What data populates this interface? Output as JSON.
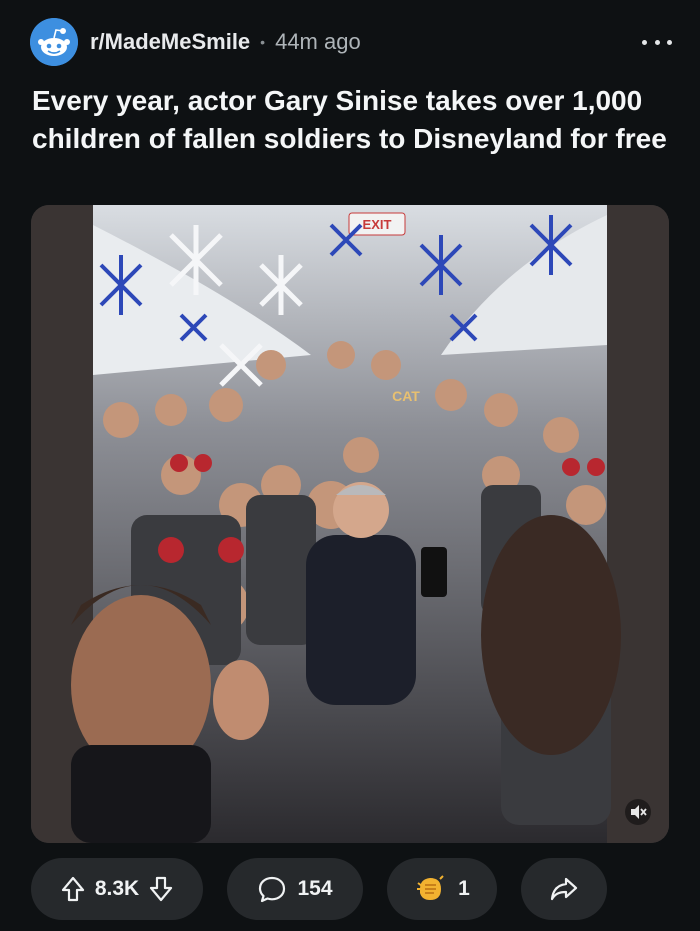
{
  "post": {
    "subreddit": "r/MadeMeSmile",
    "separator": "•",
    "time": "44m ago",
    "title": "Every year, actor Gary Sinise takes over 1,000 children of fallen soldiers to Disneyland for free",
    "media": {
      "sign_text": "EXIT",
      "shirt_text": "CAT"
    }
  },
  "actions": {
    "votes": "8.3K",
    "comments": "154",
    "awards": "1"
  },
  "icons": {
    "subreddit_avatar": "reddit-snoo-icon",
    "more": "more-options-icon",
    "upvote": "upvote-arrow-icon",
    "downvote": "downvote-arrow-icon",
    "comment": "comment-bubble-icon",
    "award": "award-hand-icon",
    "share": "share-arrow-icon",
    "mute": "muted-speaker-icon"
  },
  "colors": {
    "background": "#0e1113",
    "pill": "#26292c",
    "avatar": "#3d8fe0",
    "award": "#f2b230"
  }
}
